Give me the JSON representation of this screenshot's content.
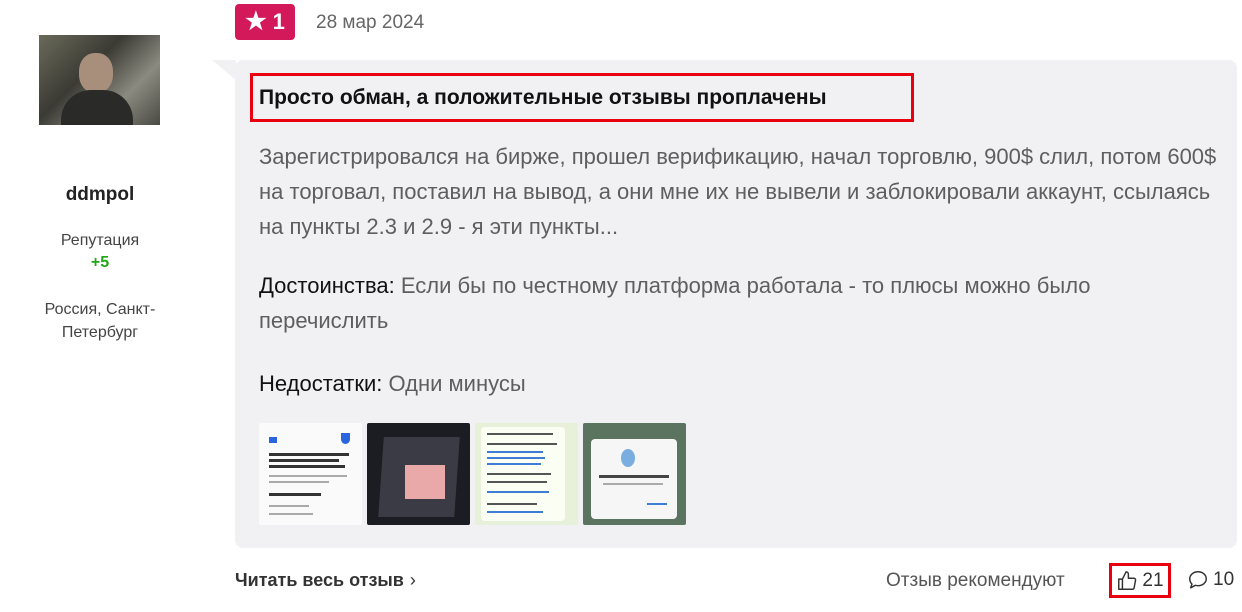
{
  "author": {
    "name": "ddmpol",
    "reputation_label": "Репутация",
    "reputation_value": "+5",
    "location": "Россия, Санкт-Петербург"
  },
  "review": {
    "rating": "1",
    "date": "28 мар 2024",
    "title": "Просто обман, а положительные отзывы проплачены",
    "body": "Зарегистрировался на бирже, прошел верификацию, начал торговлю, 900$ слил, потом 600$ на торговал, поставил на вывод, а они мне их не вывели и заблокировали аккаунт, ссылаясь на пункты 2.3 и 2.9 - я эти пункты...",
    "pros_label": "Достоинства:",
    "pros_text": "Если бы по честному платформа работала - то плюсы можно было перечислить",
    "cons_label": "Недостатки:",
    "cons_text": "Одни минусы"
  },
  "footer": {
    "read_more": "Читать весь отзыв",
    "recommend_label": "Отзыв рекомендуют",
    "likes": "21",
    "comments": "10"
  },
  "icons": {
    "star": "star-icon",
    "chevron": "chevron-right-icon",
    "thumbs_up": "thumbs-up-icon",
    "comment": "comment-icon"
  },
  "colors": {
    "badge": "#d4195a",
    "highlight": "#e8000f",
    "positive": "#1fa614"
  }
}
